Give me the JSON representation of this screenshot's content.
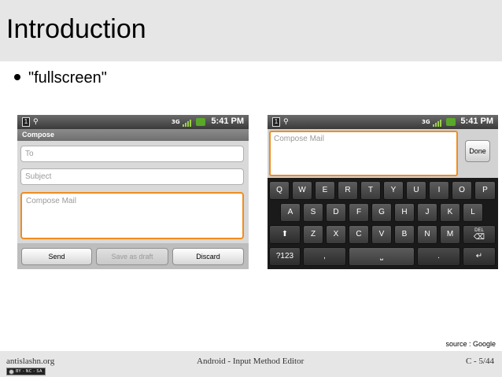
{
  "slide": {
    "title": "Introduction",
    "bullet": "\"fullscreen\""
  },
  "left_screen": {
    "status": {
      "indicator_3g": "3G",
      "time": "5:41 PM"
    },
    "header": "Compose",
    "fields": {
      "to_placeholder": "To",
      "subject_placeholder": "Subject",
      "body_placeholder": "Compose Mail"
    },
    "buttons": {
      "send": "Send",
      "save_draft": "Save as draft",
      "discard": "Discard"
    }
  },
  "right_screen": {
    "status": {
      "indicator_3g": "3G",
      "time": "5:41 PM"
    },
    "body_placeholder": "Compose Mail",
    "done": "Done",
    "keyboard": {
      "row1": [
        "Q",
        "W",
        "E",
        "R",
        "T",
        "Y",
        "U",
        "I",
        "O",
        "P"
      ],
      "row2": [
        "A",
        "S",
        "D",
        "F",
        "G",
        "H",
        "J",
        "K",
        "L"
      ],
      "row3": [
        "Z",
        "X",
        "C",
        "V",
        "B",
        "N",
        "M"
      ],
      "shift_glyph": "⬆",
      "delete_top": "DEL",
      "delete_glyph": "⌫",
      "symbols": "?123",
      "comma": ",",
      "space_glyph": "⎵",
      "period": ".",
      "enter_glyph": "↵"
    }
  },
  "source_note": "source : Google",
  "footer": {
    "left": "antislashn.org",
    "center": "Android - Input Method Editor",
    "right": "C - 5/44",
    "license": "BY - NC - SA"
  }
}
